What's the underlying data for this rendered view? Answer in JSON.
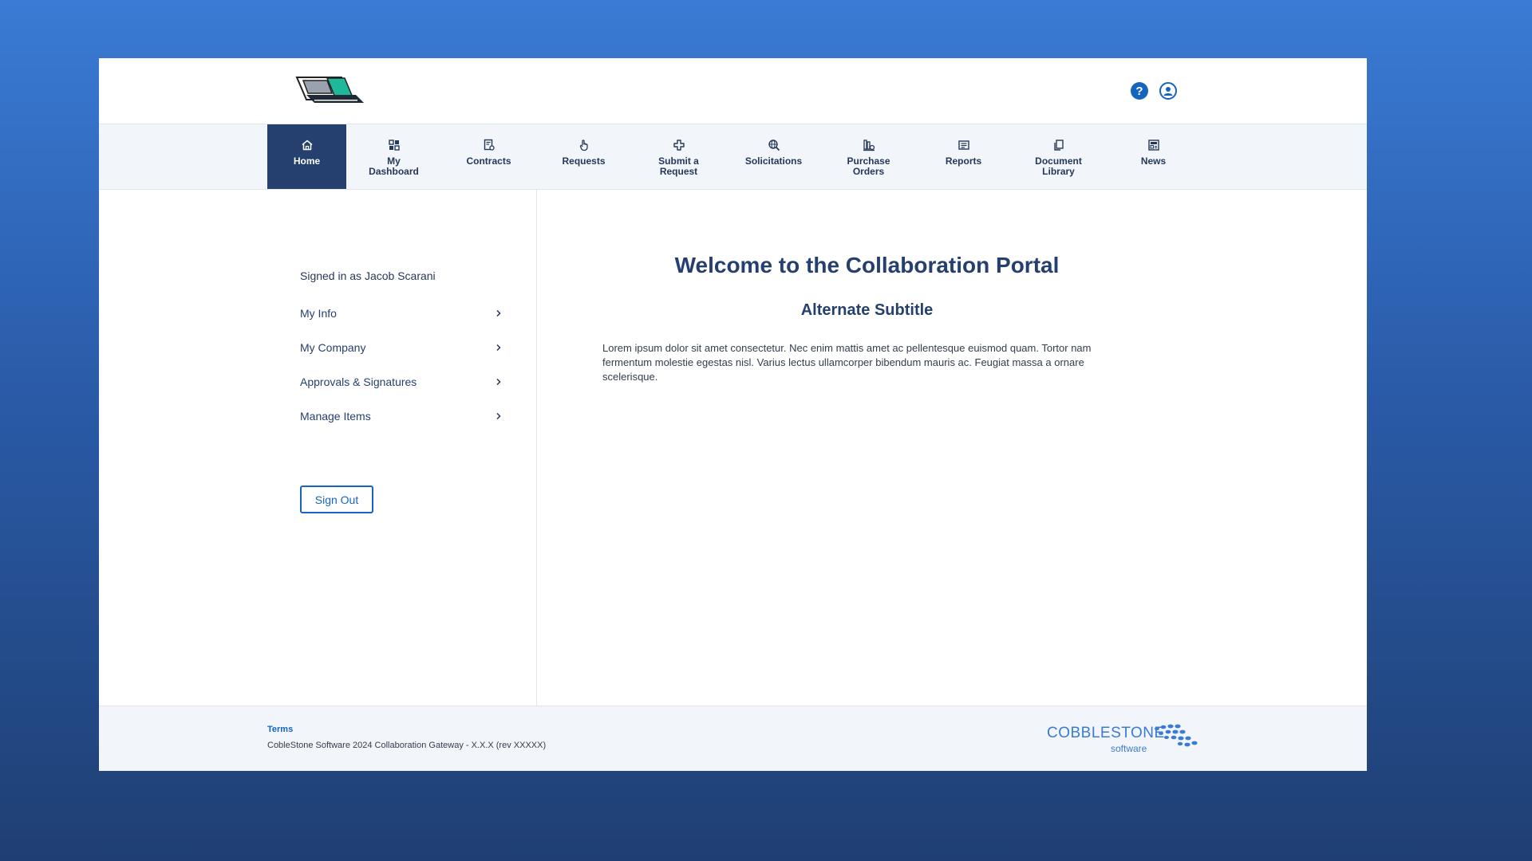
{
  "header": {
    "logo_icon": "company-logo",
    "help_icon": "question-circle-icon",
    "help_glyph": "?",
    "user_icon": "user-circle-icon"
  },
  "nav": {
    "items": [
      {
        "label": "Home",
        "icon": "home-icon",
        "active": true
      },
      {
        "label": "My Dashboard",
        "icon": "dashboard-icon"
      },
      {
        "label": "Contracts",
        "icon": "contracts-icon"
      },
      {
        "label": "Requests",
        "icon": "hand-pointer-icon"
      },
      {
        "label": "Submit a Request",
        "icon": "plus-cross-icon"
      },
      {
        "label": "Solicitations",
        "icon": "search-globe-icon"
      },
      {
        "label": "Purchase Orders",
        "icon": "purchase-orders-icon"
      },
      {
        "label": "Reports",
        "icon": "reports-icon"
      },
      {
        "label": "Document Library",
        "icon": "documents-icon"
      },
      {
        "label": "News",
        "icon": "news-icon"
      }
    ]
  },
  "sidebar": {
    "signed_in": "Signed in as Jacob Scarani",
    "items": [
      {
        "label": "My Info"
      },
      {
        "label": "My Company"
      },
      {
        "label": "Approvals & Signatures"
      },
      {
        "label": "Manage Items"
      }
    ],
    "sign_out": "Sign Out"
  },
  "main": {
    "title": "Welcome to the Collaboration Portal",
    "subtitle": "Alternate Subtitle",
    "body": "Lorem ipsum dolor sit amet consectetur. Nec enim mattis amet ac pellentesque euismod quam. Tortor nam fermentum molestie egestas nisl. Varius lectus ullamcorper bibendum mauris ac. Feugiat massa a ornare scelerisque."
  },
  "footer": {
    "terms": "Terms",
    "copyright": "CobleStone Software 2024 Collaboration Gateway - X.X.X (rev XXXXX)",
    "brand_name": "COBBLESTONE",
    "brand_sub": "software"
  },
  "colors": {
    "background_top": "#3a7bd5",
    "background_bottom": "#1f3f73",
    "nav_active": "#253f6e",
    "accent": "#1565c0",
    "text_dark": "#253858"
  }
}
